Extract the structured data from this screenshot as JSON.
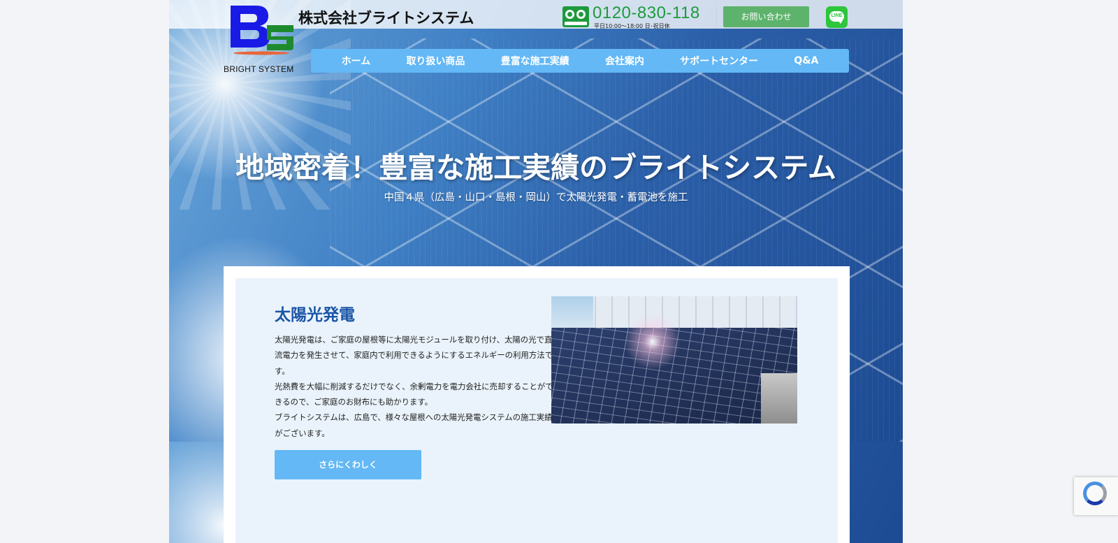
{
  "header": {
    "logo_text": "BRIGHT SYSTEM",
    "company_name": "株式会社ブライトシステム",
    "phone_number": "0120-830-118",
    "phone_hours": "平日10:00〜18:00 日･祝日休",
    "contact_button": "お問い合わせ",
    "line_button": "LINE"
  },
  "nav": {
    "items": [
      {
        "label": "ホーム"
      },
      {
        "label": "取り扱い商品"
      },
      {
        "label": "豊富な施工実績"
      },
      {
        "label": "会社案内"
      },
      {
        "label": "サポートセンター"
      },
      {
        "label": "Q&A"
      }
    ]
  },
  "hero": {
    "title": "地域密着！豊富な施工実績のブライトシステム",
    "subtitle": "中国４県（広島・山口・島根・岡山）で太陽光発電・蓄電池を施工"
  },
  "section": {
    "title": "太陽光発電",
    "body": [
      "太陽光発電は、ご家庭の屋根等に太陽光モジュールを取り付け、太陽の光で直流電力を発生させて、家庭内で利用できるようにするエネルギーの利用方法です。",
      "光熱費を大幅に削減するだけでなく、余剰電力を電力会社に売却することができるので、ご家庭のお財布にも助かります。",
      "ブライトシステムは、広島で、様々な屋根への太陽光発電システムの施工実績がございます。"
    ],
    "more_button": "さらにくわしく"
  },
  "colors": {
    "nav_bg": "#63b8f5",
    "phone_green": "#1e9a3c",
    "contact_green": "#5db36c",
    "title_blue": "#1a55a6",
    "line_green": "#2fc53d"
  }
}
